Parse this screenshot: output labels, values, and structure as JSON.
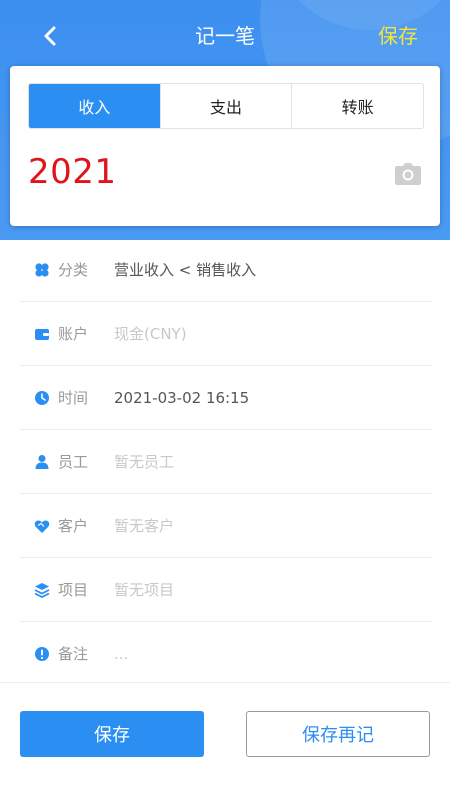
{
  "header": {
    "title": "记一笔",
    "save_label": "保存",
    "back_icon": "chevron-left-icon",
    "color_bg": "#3d8ff0",
    "color_save": "#f5e53b"
  },
  "tabs": [
    {
      "label": "收入",
      "active": true
    },
    {
      "label": "支出",
      "active": false
    },
    {
      "label": "转账",
      "active": false
    }
  ],
  "amount": {
    "value": "2021",
    "color": "#e0141b",
    "camera_icon": "camera-icon"
  },
  "fields": [
    {
      "icon": "category-icon",
      "label": "分类",
      "value": "营业收入 < 销售收入",
      "placeholder": false
    },
    {
      "icon": "wallet-icon",
      "label": "账户",
      "value": "现金(CNY)",
      "placeholder": true
    },
    {
      "icon": "clock-icon",
      "label": "时间",
      "value": "2021-03-02 16:15",
      "placeholder": false
    },
    {
      "icon": "person-icon",
      "label": "员工",
      "value": "暂无员工",
      "placeholder": true
    },
    {
      "icon": "handshake-icon",
      "label": "客户",
      "value": "暂无客户",
      "placeholder": true
    },
    {
      "icon": "layers-icon",
      "label": "项目",
      "value": "暂无项目",
      "placeholder": true
    },
    {
      "icon": "alert-icon",
      "label": "备注",
      "value": "...",
      "placeholder": true
    }
  ],
  "footer": {
    "save_label": "保存",
    "save_again_label": "保存再记",
    "accent_color": "#2a8ef2"
  }
}
